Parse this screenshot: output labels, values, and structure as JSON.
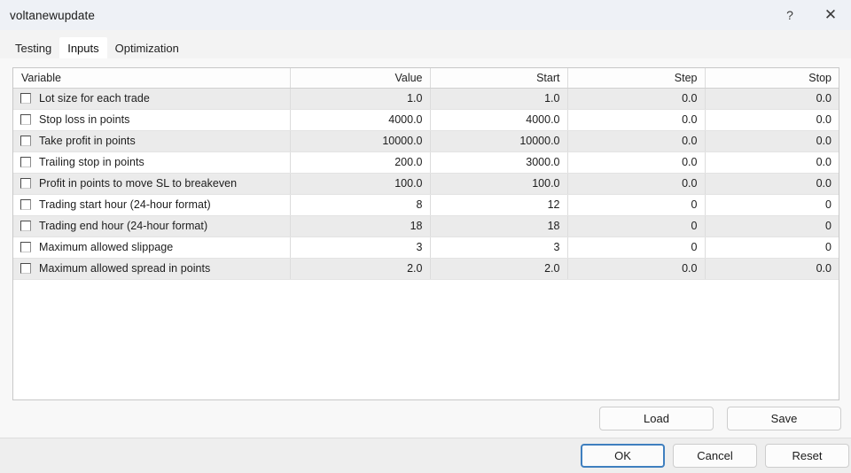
{
  "window": {
    "title": "voltanewupdate",
    "controls": [
      {
        "name": "help-button",
        "glyph": "?"
      },
      {
        "name": "close-button",
        "glyph": "✕"
      }
    ]
  },
  "tabs": [
    {
      "label": "Testing",
      "active": false
    },
    {
      "label": "Inputs",
      "active": true
    },
    {
      "label": "Optimization",
      "active": false
    }
  ],
  "table": {
    "columns": [
      "Variable",
      "Value",
      "Start",
      "Step",
      "Stop"
    ],
    "rows": [
      {
        "checked": false,
        "variable": "Lot size for each trade",
        "value": "1.0",
        "start": "1.0",
        "step": "0.0",
        "stop": "0.0"
      },
      {
        "checked": false,
        "variable": "Stop loss in points",
        "value": "4000.0",
        "start": "4000.0",
        "step": "0.0",
        "stop": "0.0"
      },
      {
        "checked": false,
        "variable": "Take profit in points",
        "value": "10000.0",
        "start": "10000.0",
        "step": "0.0",
        "stop": "0.0"
      },
      {
        "checked": false,
        "variable": "Trailing stop in points",
        "value": "200.0",
        "start": "3000.0",
        "step": "0.0",
        "stop": "0.0"
      },
      {
        "checked": false,
        "variable": "Profit in points to move SL to breakeven",
        "value": "100.0",
        "start": "100.0",
        "step": "0.0",
        "stop": "0.0"
      },
      {
        "checked": false,
        "variable": "Trading start hour (24-hour format)",
        "value": "8",
        "start": "12",
        "step": "0",
        "stop": "0"
      },
      {
        "checked": false,
        "variable": "Trading end hour (24-hour format)",
        "value": "18",
        "start": "18",
        "step": "0",
        "stop": "0"
      },
      {
        "checked": false,
        "variable": "Maximum allowed slippage",
        "value": "3",
        "start": "3",
        "step": "0",
        "stop": "0"
      },
      {
        "checked": false,
        "variable": "Maximum allowed spread in points",
        "value": "2.0",
        "start": "2.0",
        "step": "0.0",
        "stop": "0.0"
      }
    ]
  },
  "actions": {
    "load": "Load",
    "save": "Save",
    "ok": "OK",
    "cancel": "Cancel",
    "reset": "Reset"
  },
  "colors": {
    "titlebar": "#eef1f6",
    "tabstrip": "#f3f3f3",
    "body": "#f8f8f8",
    "bottombar": "#eeeeee",
    "row_alt": "#ebebeb",
    "focus_accent": "#3f7fbf"
  }
}
